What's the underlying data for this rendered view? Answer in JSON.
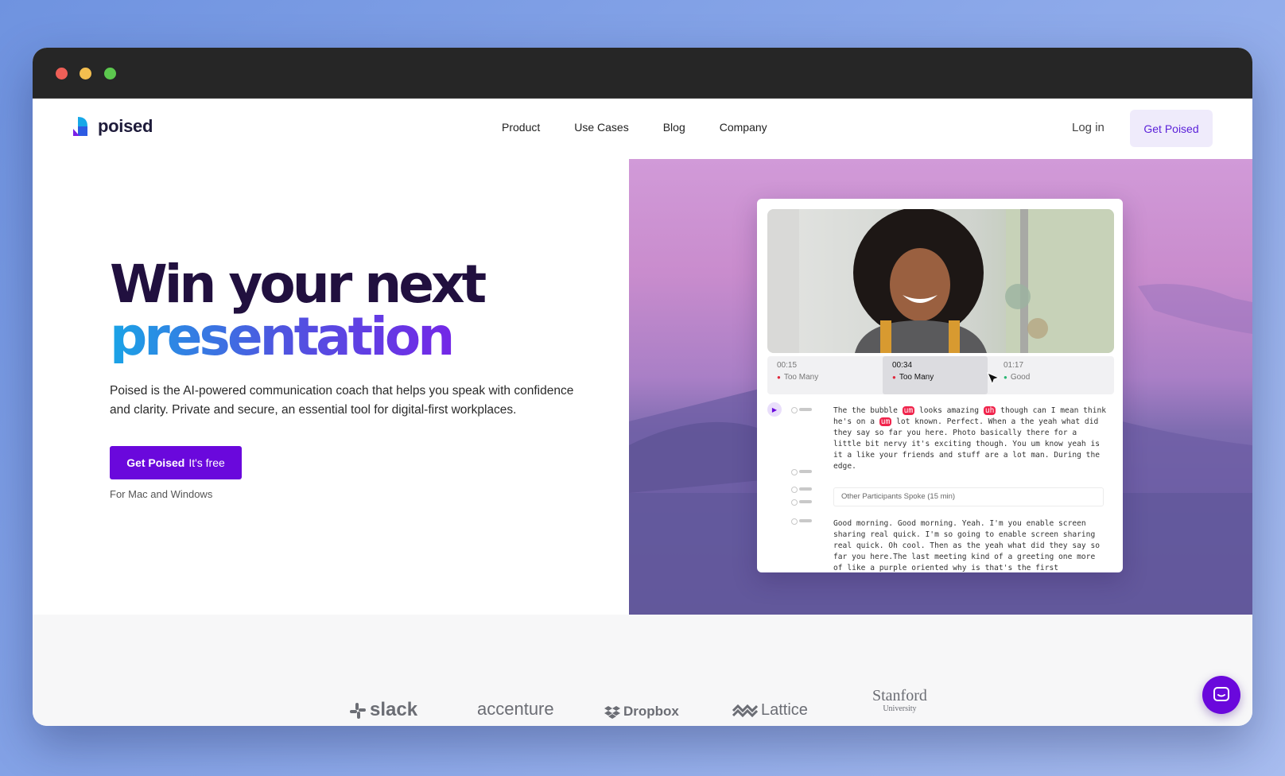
{
  "nav": {
    "brand": "poised",
    "links": [
      "Product",
      "Use Cases",
      "Blog",
      "Company"
    ],
    "login": "Log in",
    "cta": "Get Poised"
  },
  "hero": {
    "title_line1": "Win your next",
    "title_line2": "presentation",
    "subtitle": "Poised is the AI-powered communication coach that helps you speak with confidence and clarity. Private and secure, an essential tool for digital-first workplaces.",
    "cta_bold": "Get Poised",
    "cta_rest": "It's free",
    "platforms": "For Mac and Windows"
  },
  "app": {
    "timeline": [
      {
        "time": "00:15",
        "status": "Too Many",
        "level": "bad"
      },
      {
        "time": "00:34",
        "status": "Too Many",
        "level": "bad"
      },
      {
        "time": "01:17",
        "status": "Good",
        "level": "good"
      }
    ],
    "transcript1": [
      {
        "text": "The the bubble "
      },
      {
        "text": "um",
        "filler": true
      },
      {
        "text": " looks amazing "
      },
      {
        "text": "uh",
        "filler": true
      },
      {
        "text": " though can I mean think he's on a "
      },
      {
        "text": "um",
        "filler": true
      },
      {
        "text": " lot known. Perfect. When a the yeah what did they say so far you here. Photo basically there for a little bit nervy it's exciting though. You um know yeah is it a like your friends and stuff are a lot man. During the edge."
      }
    ],
    "other_participants": "Other Participants Spoke (15 min)",
    "transcript2": "Good morning. Good morning. Yeah. I'm you enable screen sharing real quick. I'm so going to enable screen sharing real quick. Oh cool. Then as the yeah what did they say so far you here.The last meeting kind of a greeting one more of like a purple oriented why is that's the first"
  },
  "logos": [
    "slack",
    "accenture",
    "Dropbox",
    "Lattice",
    "Stanford",
    "University"
  ],
  "colors": {
    "accent": "#6a08dc",
    "filler_highlight": "#f0234b",
    "title_dark": "#21103f"
  }
}
